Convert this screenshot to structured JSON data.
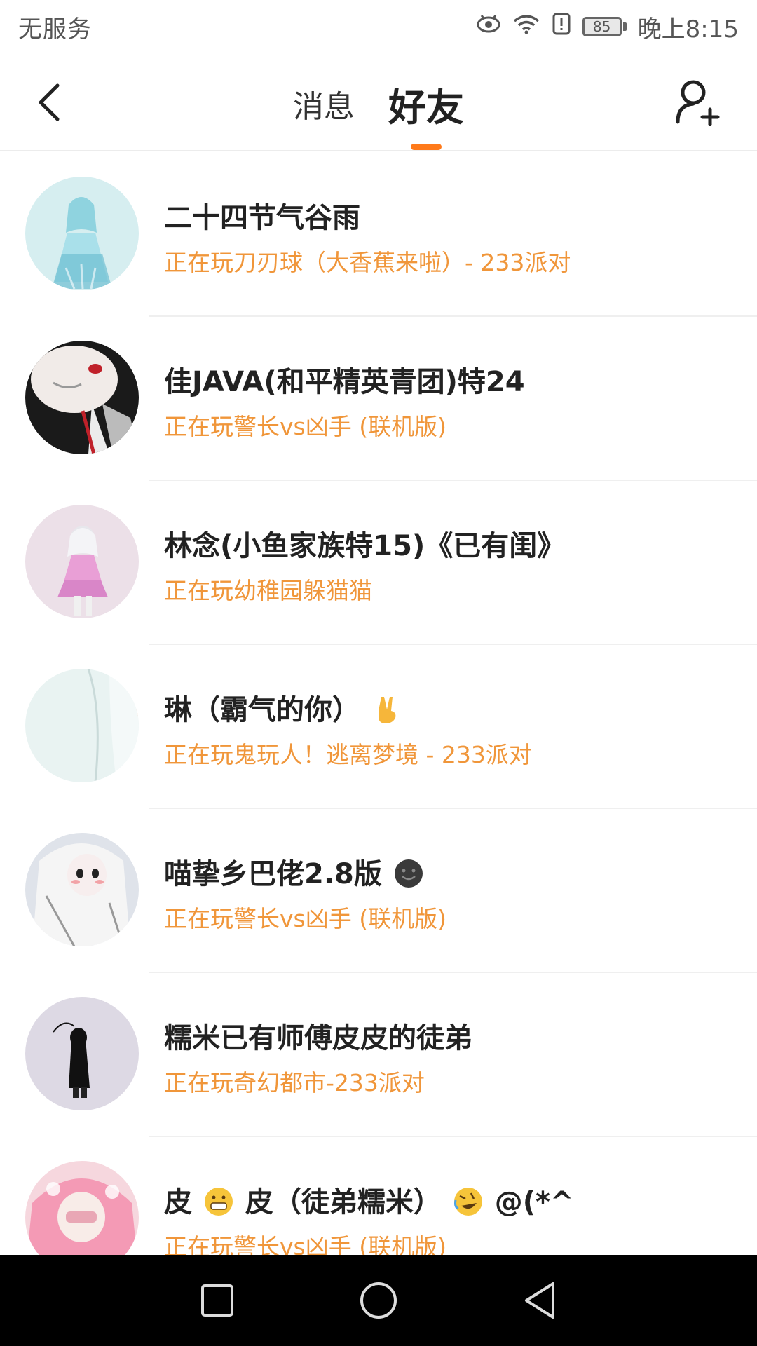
{
  "status_bar": {
    "carrier": "无服务",
    "battery": "85",
    "time": "晚上8:15"
  },
  "header": {
    "tabs": [
      {
        "label": "消息",
        "active": false
      },
      {
        "label": "好友",
        "active": true
      }
    ],
    "accent_color": "#ff7a1a"
  },
  "friends": [
    {
      "name": "二十四节气谷雨",
      "status": "正在玩刀刃球（大香蕉来啦）- 233派对"
    },
    {
      "name": "佳JAVA(和平精英青团)特24",
      "status": "正在玩警长vs凶手 (联机版)"
    },
    {
      "name": "林念(小鱼家族特15)《已有闺》",
      "status": "正在玩幼稚园躲猫猫"
    },
    {
      "name": "琳（霸气的你）",
      "status": "正在玩鬼玩人！逃离梦境 - 233派对"
    },
    {
      "name": "喵挚乡巴佬2.8版",
      "status": "正在玩警长vs凶手 (联机版)"
    },
    {
      "name": "糯米已有师傅皮皮的徒弟",
      "status": "正在玩奇幻都市-233派对"
    },
    {
      "name_part1": "皮",
      "name_part2": "皮（徒弟糯米）",
      "name_part3": "@(*^",
      "status": "正在玩警长vs凶手 (联机版)"
    }
  ],
  "colors": {
    "status_orange": "#f0963a",
    "name_dark": "#222222"
  }
}
